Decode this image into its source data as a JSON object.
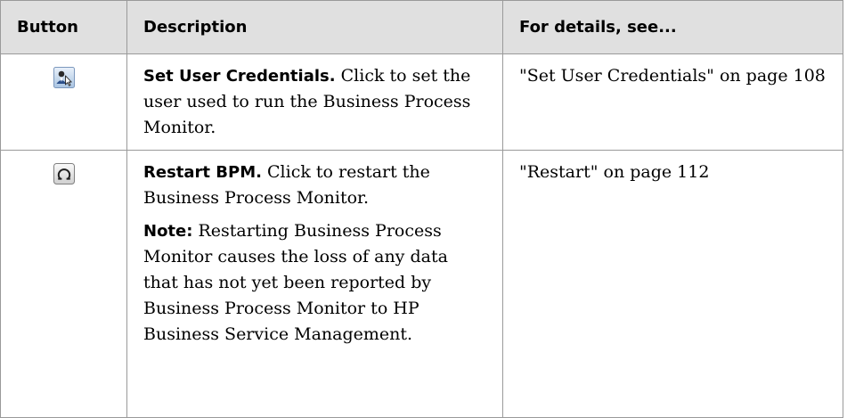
{
  "table": {
    "headers": {
      "button": "Button",
      "description": "Description",
      "details": "For details, see..."
    },
    "rows": [
      {
        "icon": "set-user-credentials-icon",
        "title": "Set User Credentials.",
        "description": "Click to set the user used to run the Business Process Monitor.",
        "details": "\"Set User Credentials\" on page 108"
      },
      {
        "icon": "restart-icon",
        "title": "Restart BPM.",
        "description": "Click to restart the Business Process Monitor.",
        "note_label": "Note:",
        "note_text": "Restarting Business Process Monitor causes the loss of any data that has not yet been reported by Business Process Monitor to HP Business Service Management.",
        "details": "\"Restart\" on page 112"
      }
    ]
  }
}
